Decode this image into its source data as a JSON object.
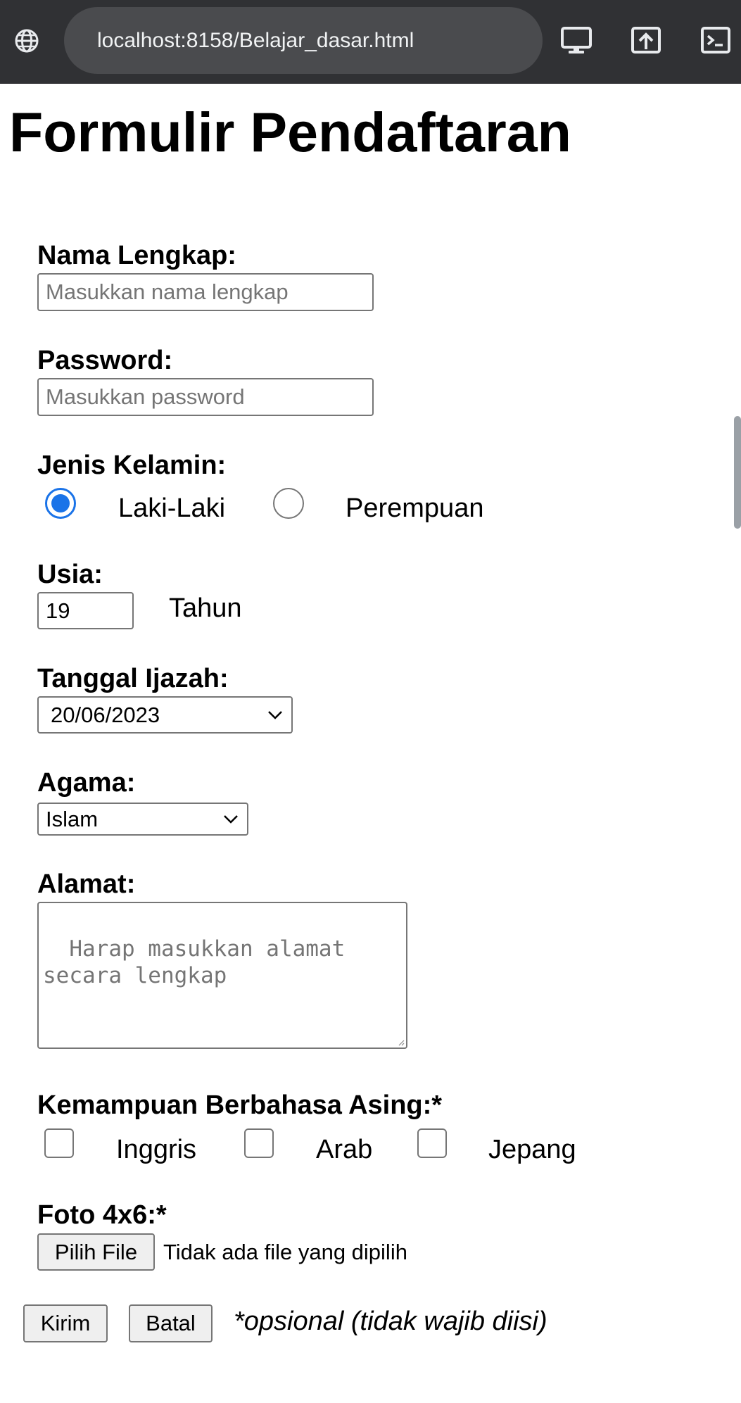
{
  "browser": {
    "url": "localhost:8158/Belajar_dasar.html",
    "icons": [
      "globe-icon",
      "desktop-icon",
      "share-icon",
      "terminal-icon"
    ],
    "bar_color": "#303134"
  },
  "form": {
    "title": "Formulir Pendaftaran",
    "nama": {
      "label": "Nama Lengkap:",
      "placeholder": "Masukkan nama lengkap"
    },
    "password": {
      "label": "Password:",
      "placeholder": "Masukkan password"
    },
    "gender": {
      "label": "Jenis Kelamin:",
      "options": [
        {
          "label": "Laki-Laki",
          "checked": true
        },
        {
          "label": "Perempuan",
          "checked": false
        }
      ]
    },
    "usia": {
      "label": "Usia:",
      "value": "19",
      "unit": "Tahun"
    },
    "tanggal": {
      "label": "Tanggal Ijazah:",
      "value": "20/06/2023"
    },
    "agama": {
      "label": "Agama:",
      "selected": "Islam"
    },
    "alamat": {
      "label": "Alamat:",
      "placeholder": "Harap masukkan alamat\nsecara lengkap"
    },
    "bahasa": {
      "label": "Kemampuan Berbahasa Asing:*",
      "options": [
        "Inggris",
        "Arab",
        "Jepang"
      ]
    },
    "foto": {
      "label": "Foto 4x6:*",
      "button": "Pilih File",
      "status": "Tidak ada file yang dipilih"
    },
    "submit": "Kirim",
    "cancel": "Batal",
    "note": "*opsional (tidak wajib diisi)"
  },
  "colors": {
    "accent": "#1a73e8",
    "border": "#767676",
    "button_bg": "#efefef"
  }
}
